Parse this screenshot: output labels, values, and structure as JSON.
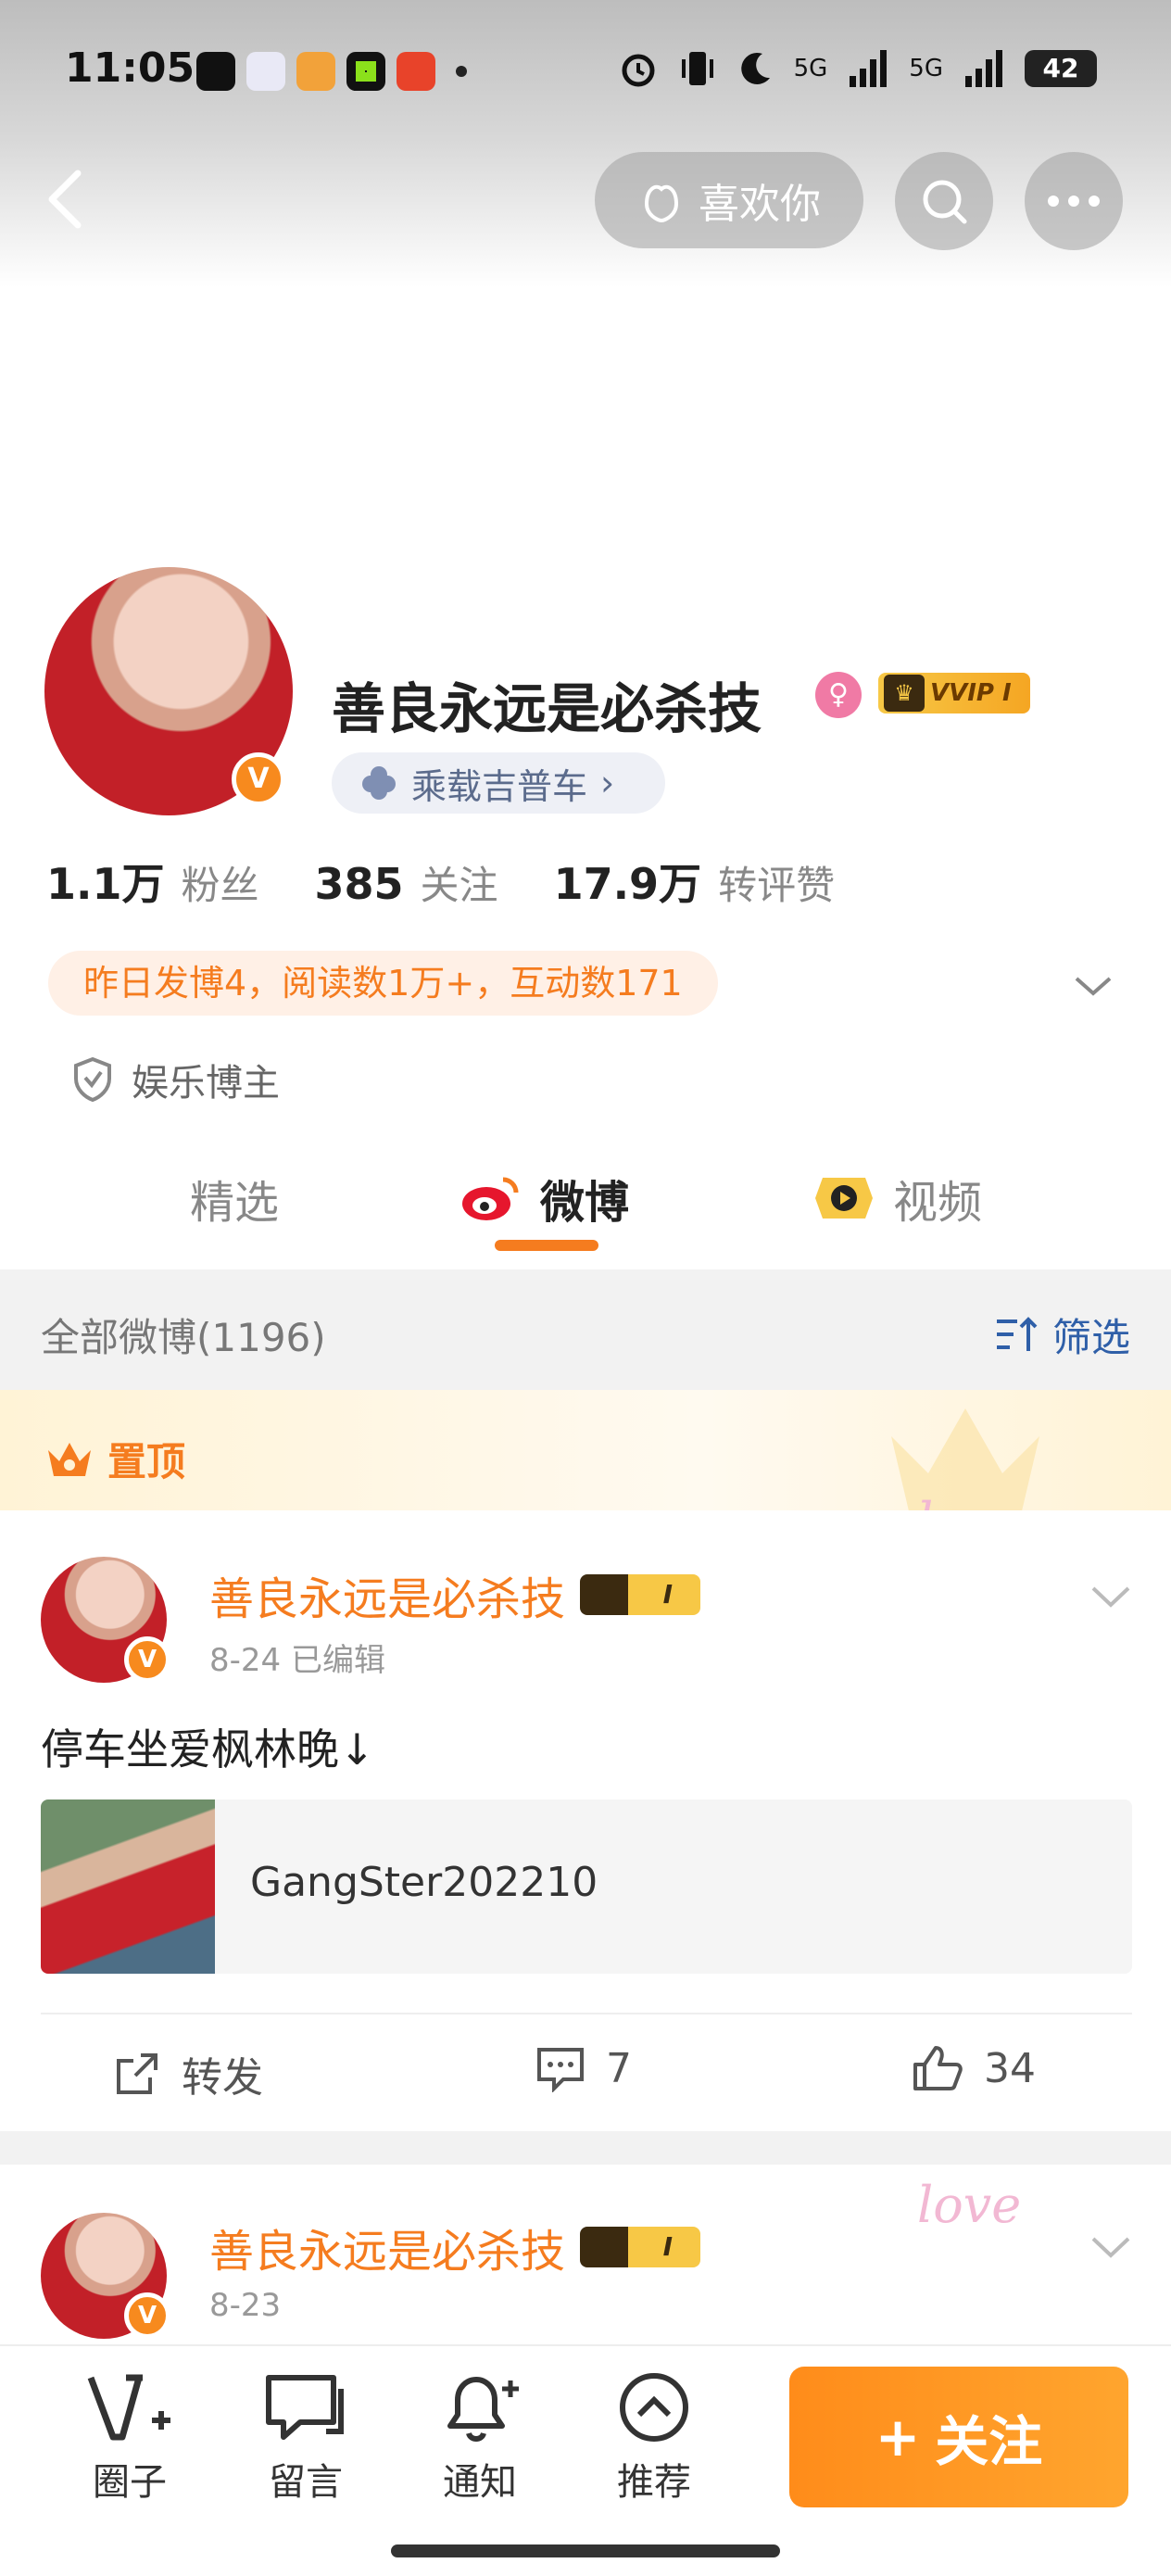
{
  "status_bar": {
    "time": "11:05",
    "network1": "5G",
    "network2": "5G",
    "battery": "42"
  },
  "header": {
    "like_label": "喜欢你"
  },
  "profile": {
    "name": "善良永远是必杀技",
    "vip_label": "VVIP I",
    "vip_crown": "♛",
    "car_tag": "乘载吉普车",
    "car_chevron": "›",
    "verify_mark": "V",
    "gender_mark": "♀",
    "stats": {
      "fans_num": "1.1万",
      "fans_label": "粉丝",
      "follow_num": "385",
      "follow_label": "关注",
      "likes_num": "17.9万",
      "likes_label": "转评赞"
    },
    "activity": "昨日发博4，阅读数1万+，互动数171",
    "blogger_tag": "娱乐博主"
  },
  "tabs": [
    {
      "label": "精选"
    },
    {
      "label": "微博"
    },
    {
      "label": "视频"
    }
  ],
  "filter": {
    "title": "全部微博(1196)",
    "button": "筛选"
  },
  "pinned": {
    "label": "置顶",
    "deco": "love"
  },
  "posts": [
    {
      "name": "善良永远是必杀技",
      "badge": "I",
      "meta": "8-24   已编辑",
      "text": "停车坐爱枫林晚↓",
      "link": "GangSter202210",
      "repost": "转发",
      "comments": "7",
      "likes": "34"
    },
    {
      "name": "善良永远是必杀技",
      "badge": "I",
      "meta": "8-23",
      "deco": "love"
    }
  ],
  "bottom_nav": [
    {
      "label": "圈子"
    },
    {
      "label": "留言"
    },
    {
      "label": "通知"
    },
    {
      "label": "推荐"
    }
  ],
  "follow_button": "关注",
  "follow_plus": "+",
  "colors": {
    "accent": "#f57c1f",
    "link": "#2f5fa8",
    "vip_gold": "#f7c846"
  }
}
